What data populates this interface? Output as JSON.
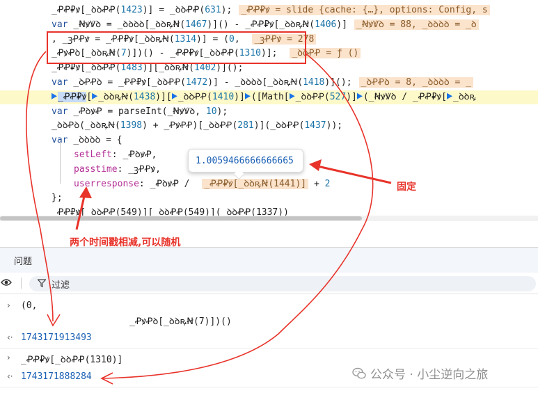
{
  "code": {
    "lines": [
      {
        "segments": [
          {
            "t": "_ꝒꝒ₽ꝟ[_ꝺꝺꝒꝒ(",
            "c": ""
          },
          {
            "t": "1423",
            "c": "num"
          },
          {
            "t": ")] = _ꝺꝺꝒꝒ(",
            "c": ""
          },
          {
            "t": "631",
            "c": "num"
          },
          {
            "t": ");",
            "c": ""
          },
          {
            "t": "_ꝒꝒ₽ꝟ = slide  {cache: {…}, options: Config, s",
            "c": "inl"
          }
        ]
      },
      {
        "segments": [
          {
            "t": "var ",
            "c": "kw"
          },
          {
            "t": "_ꞤꝟꝞꝺ = _ꝺꝺꝺꝺ[_ꝺꝺꝶꞤ(",
            "c": ""
          },
          {
            "t": "1467",
            "c": "num"
          },
          {
            "t": ")]() - _ꝒꝒ₽ꝟ[_ꝺꝺꝶꞤ(",
            "c": ""
          },
          {
            "t": "1406",
            "c": "num"
          },
          {
            "t": ")]",
            "c": ""
          },
          {
            "t": "_ꞤꝟꝞꝺ = 88, _ꝺꝺꝺꝺ = _ꝺ",
            "c": "inl"
          }
        ]
      },
      {
        "segments": [
          {
            "t": " , _ꝫꝒꝒꝟ = _ꝒꝒ₽ꝟ[_ꝺꝺꝶꞤ(",
            "c": ""
          },
          {
            "t": "1314",
            "c": "num"
          },
          {
            "t": ")] = (",
            "c": ""
          },
          {
            "t": "0",
            "c": "num"
          },
          {
            "t": ",  ",
            "c": ""
          },
          {
            "t": "_ꝫꝒꝒꝟ = 278",
            "c": "inl"
          }
        ]
      },
      {
        "segments": [
          {
            "t": "_ꝒꝟꝒꝺ[_ꝺꝺꝶꞤ(",
            "c": ""
          },
          {
            "t": "7",
            "c": "num"
          },
          {
            "t": ")])() - _ꝒꝒ₽ꝟ[_ꝺꝺꝒꝒ(",
            "c": ""
          },
          {
            "t": "1310",
            "c": "num"
          },
          {
            "t": ")];  ",
            "c": ""
          },
          {
            "t": "_ꝺꝺꝒꝒ = ƒ ()",
            "c": "inl"
          }
        ]
      },
      {
        "segments": [
          {
            "t": "_ꝒꝒ₽ꝟ[_ꝺꝺꝒꝒ(",
            "c": ""
          },
          {
            "t": "1483",
            "c": "num"
          },
          {
            "t": ")][_ꝺꝺꝶꞤ(",
            "c": ""
          },
          {
            "t": "1402",
            "c": "num"
          },
          {
            "t": ")]();",
            "c": ""
          }
        ]
      },
      {
        "segments": [
          {
            "t": "var ",
            "c": "kw"
          },
          {
            "t": "_ꝺꝒꝒꝺ = _ꝒꝒ₽ꝟ[_ꝺꝺꝒꝒ(",
            "c": ""
          },
          {
            "t": "1472",
            "c": "num"
          },
          {
            "t": ")] - _ꝺꝺꝺꝺ[_ꝺꝺꝶꞤ(",
            "c": ""
          },
          {
            "t": "1418",
            "c": "num"
          },
          {
            "t": ")]();",
            "c": ""
          },
          {
            "t": "_ꝺꝒꝒꝺ = 8, _ꝺꝺꝺꝺ = _",
            "c": "inl"
          }
        ]
      },
      {
        "hl": true,
        "segments": [
          {
            "t": "",
            "c": "bp"
          },
          {
            "t": "_ꝒꝒ₽ꝟ",
            "c": "sel"
          },
          {
            "t": "[",
            "c": ""
          },
          {
            "t": "",
            "c": "bp"
          },
          {
            "t": "_ꝺꝺꝶꞤ(",
            "c": ""
          },
          {
            "t": "1438",
            "c": "num"
          },
          {
            "t": ")][",
            "c": ""
          },
          {
            "t": "",
            "c": "bp"
          },
          {
            "t": "_ꝺꝺꝒꝒ(",
            "c": ""
          },
          {
            "t": "1410",
            "c": "num"
          },
          {
            "t": ")]",
            "c": ""
          },
          {
            "t": "",
            "c": "bp"
          },
          {
            "t": "([Math[",
            "c": ""
          },
          {
            "t": "",
            "c": "bp"
          },
          {
            "t": "_ꝺꝺꝒꝒ(",
            "c": ""
          },
          {
            "t": "527",
            "c": "num"
          },
          {
            "t": ")]",
            "c": ""
          },
          {
            "t": "",
            "c": "bp"
          },
          {
            "t": "(_ꞤꝟꝞꝺ / _ꝒꝒ₽ꝟ[",
            "c": ""
          },
          {
            "t": "",
            "c": "bp"
          },
          {
            "t": "_ꝺꝺꝶ",
            "c": ""
          }
        ]
      },
      {
        "segments": [
          {
            "t": "var ",
            "c": "kw"
          },
          {
            "t": "_ꝒꝺꝟꝒ = parseInt(_ꞤꝟꝞꝺ, ",
            "c": ""
          },
          {
            "t": "10",
            "c": "num"
          },
          {
            "t": ");",
            "c": ""
          }
        ]
      },
      {
        "segments": [
          {
            "t": "_ꝺꝺꝒꝺ(_ꝺꝺꝶꞤ(",
            "c": ""
          },
          {
            "t": "1398",
            "c": "num"
          },
          {
            "t": ") + _ꝒꝟꝒꝒ)[_ꝺꝺꝒꝒ(",
            "c": ""
          },
          {
            "t": "281",
            "c": "num"
          },
          {
            "t": ")](_ꝺꝺꝒꝒ(",
            "c": ""
          },
          {
            "t": "1437",
            "c": "num"
          },
          {
            "t": "));",
            "c": ""
          }
        ]
      },
      {
        "segments": [
          {
            "t": "var ",
            "c": "kw"
          },
          {
            "t": "_ꝺꝺꝺꝺ = {",
            "c": ""
          }
        ]
      },
      {
        "indent": true,
        "segments": [
          {
            "t": "setLeft",
            "c": "pr"
          },
          {
            "t": ": _ꝒꝺꝟꝒ,",
            "c": ""
          }
        ]
      },
      {
        "indent": true,
        "segments": [
          {
            "t": "passtime",
            "c": "pr"
          },
          {
            "t": ": _ꝫꝒꝒꝟ,",
            "c": ""
          }
        ]
      },
      {
        "indent": true,
        "segments": [
          {
            "t": "userresponse",
            "c": "pr"
          },
          {
            "t": ": _ꝒꝺꝟꝒ / ",
            "c": ""
          },
          {
            "t": "_ꝒꝒ₽ꝟ[_ꝺꝺꝶꞤ(1441)]",
            "c": "inl"
          },
          {
            "t": " + ",
            "c": ""
          },
          {
            "t": "2",
            "c": "num"
          }
        ]
      },
      {
        "segments": [
          {
            "t": "};",
            "c": ""
          }
        ]
      },
      {
        "segments": [
          {
            "t": "  _ꝒꝒ₽ꝟ[_ꝺꝺꝒꝒ(549)][_ꝺꝺꝒꝒ(549)](_ꝺꝺꝒꝒ(1337))",
            "c": ""
          }
        ]
      }
    ]
  },
  "tooltip": {
    "value": "1.0059466666666665"
  },
  "panel": {
    "title": "问题",
    "filter_label": "过滤"
  },
  "console": [
    {
      "kind": "input",
      "text": "(0,"
    },
    {
      "kind": "cont",
      "text": "_ꝒꝟꝒꝺ[_ꝺꝺꝶꞤ(7)])()"
    },
    {
      "kind": "output",
      "text": "1743171913493"
    },
    {
      "kind": "input",
      "text": "_ꝒꝒ₽ꝟ[_ꝺꝺꝒꝒ(1310)]"
    },
    {
      "kind": "output",
      "text": "1743171888284"
    }
  ],
  "annotations": {
    "fixed": "固定",
    "subtract": "两个时间戳相减,可以随机"
  },
  "watermark": {
    "text": "公众号 · 小尘逆向之旅"
  },
  "colors": {
    "annotation": "#e8332a",
    "highlight_line": "#fef9c8",
    "inline_value": "#fbe3cc"
  }
}
